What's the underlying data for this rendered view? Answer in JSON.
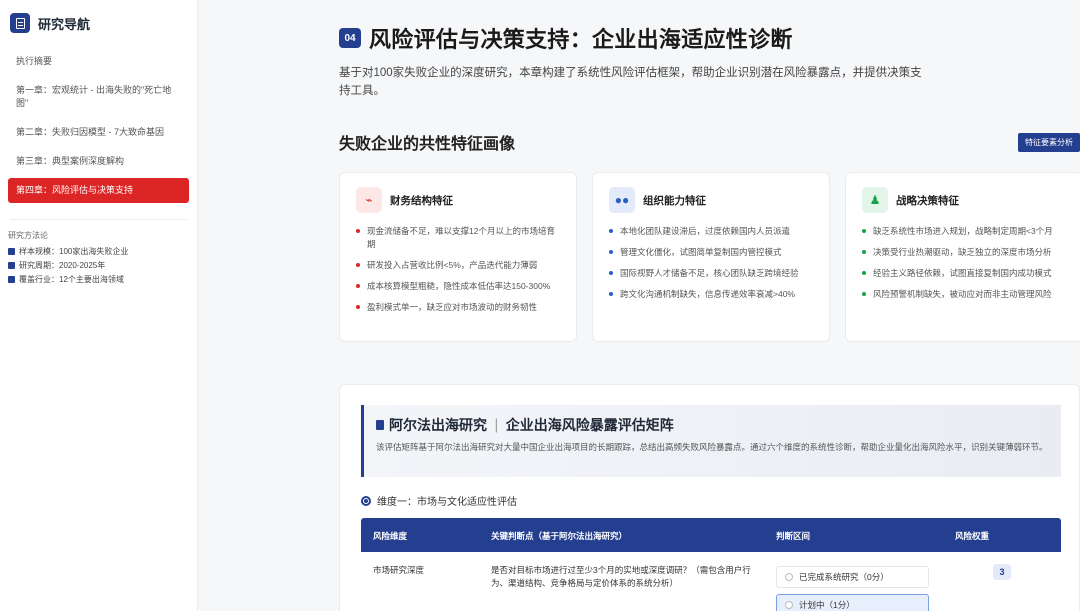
{
  "sidebar": {
    "brand_title": "研究导航",
    "items": [
      {
        "label": "执行摘要"
      },
      {
        "label": "第一章：宏观统计 - 出海失败的\"死亡地图\""
      },
      {
        "label": "第二章：失败归因模型 - 7大致命基因"
      },
      {
        "label": "第三章：典型案例深度解构"
      },
      {
        "label": "第四章：风险评估与决策支持"
      }
    ],
    "methodology": {
      "title": "研究方法论",
      "rows": [
        {
          "label": "样本规模：100家出海失败企业"
        },
        {
          "label": "研究周期：2020-2025年"
        },
        {
          "label": "覆盖行业：12个主要出海领域"
        }
      ]
    }
  },
  "header": {
    "chapter_num": "04",
    "title": "风险评估与决策支持：企业出海适应性诊断",
    "description": "基于对100家失败企业的深度研究，本章构建了系统性风险评估框架，帮助企业识别潜在风险暴露点，并提供决策支持工具。"
  },
  "profile": {
    "title": "失败企业的共性特征画像",
    "tag": "特征要素分析",
    "cards": [
      {
        "title": "财务结构特征",
        "icon": "chart-icon",
        "items": [
          "现金流储备不足，难以支撑12个月以上的市场培育期",
          "研发投入占营收比例<5%，产品迭代能力薄弱",
          "成本核算模型粗糙，隐性成本低估率达150-300%",
          "盈利模式单一，缺乏应对市场波动的财务韧性"
        ]
      },
      {
        "title": "组织能力特征",
        "icon": "team-icon",
        "items": [
          "本地化团队建设滞后，过度依赖国内人员派遣",
          "管理文化僵化，试图简单复制国内管控模式",
          "国际视野人才储备不足，核心团队缺乏跨境经验",
          "跨文化沟通机制缺失，信息传递效率衰减>40%"
        ]
      },
      {
        "title": "战略决策特征",
        "icon": "chess-icon",
        "items": [
          "缺乏系统性市场进入规划，战略制定周期<3个月",
          "决策受行业热潮驱动，缺乏独立的深度市场分析",
          "经验主义路径依赖，试图直接复制国内成功模式",
          "风险预警机制缺失，被动应对而非主动管理风险"
        ]
      }
    ]
  },
  "matrix": {
    "title_left": "阿尔法出海研究",
    "title_sep": "|",
    "title_right": "企业出海风险暴露评估矩阵",
    "description": "该评估矩阵基于阿尔法出海研究对大量中国企业出海项目的长期跟踪，总结出高频失败风险暴露点。通过六个维度的系统性诊断，帮助企业量化出海风险水平，识别关键薄弱环节。",
    "dimension": "维度一：市场与文化适应性评估",
    "columns": [
      "风险维度",
      "关键判断点（基于阿尔法出海研究）",
      "判断区间",
      "风险权重"
    ],
    "rows": [
      {
        "dimension": "市场研究深度",
        "question": "是否对目标市场进行过至少3个月的实地或深度调研？（需包含用户行为、渠道结构、竞争格局与定价体系的系统分析）",
        "options": [
          "已完成系统研究（0分）",
          "计划中（1分）"
        ],
        "weight": "3"
      }
    ]
  }
}
